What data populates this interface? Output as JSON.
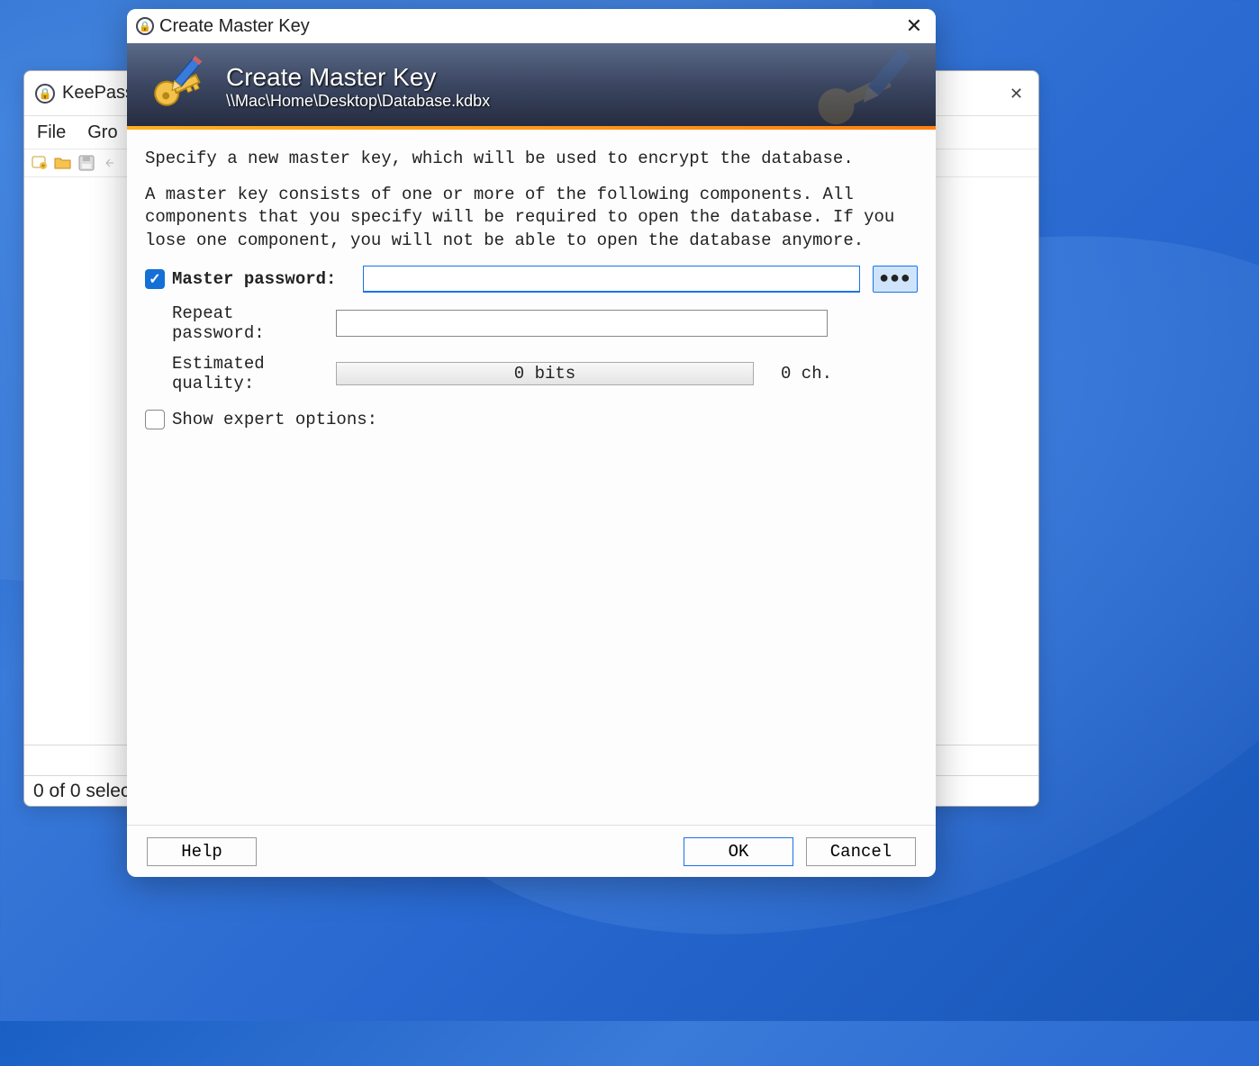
{
  "bg_window": {
    "title": "KeePass",
    "menu": {
      "file": "File",
      "group": "Gro"
    },
    "status": "0 of 0 selec"
  },
  "modal": {
    "titlebar_title": "Create Master Key",
    "header_title": "Create Master Key",
    "header_path": "\\\\Mac\\Home\\Desktop\\Database.kdbx",
    "intro1": "Specify a new master key, which will be used to encrypt the database.",
    "intro2": "A master key consists of one or more of the following components. All components that you specify will be required to open the database.  If you lose one component, you will not be able to open the database anymore.",
    "master_password_label": "Master password:",
    "repeat_password_label": "Repeat password:",
    "estimated_quality_label": "Estimated quality:",
    "quality_text": "0 bits",
    "char_count_text": "0 ch.",
    "show_expert_label": "Show expert options:",
    "buttons": {
      "help": "Help",
      "ok": "OK",
      "cancel": "Cancel"
    }
  }
}
